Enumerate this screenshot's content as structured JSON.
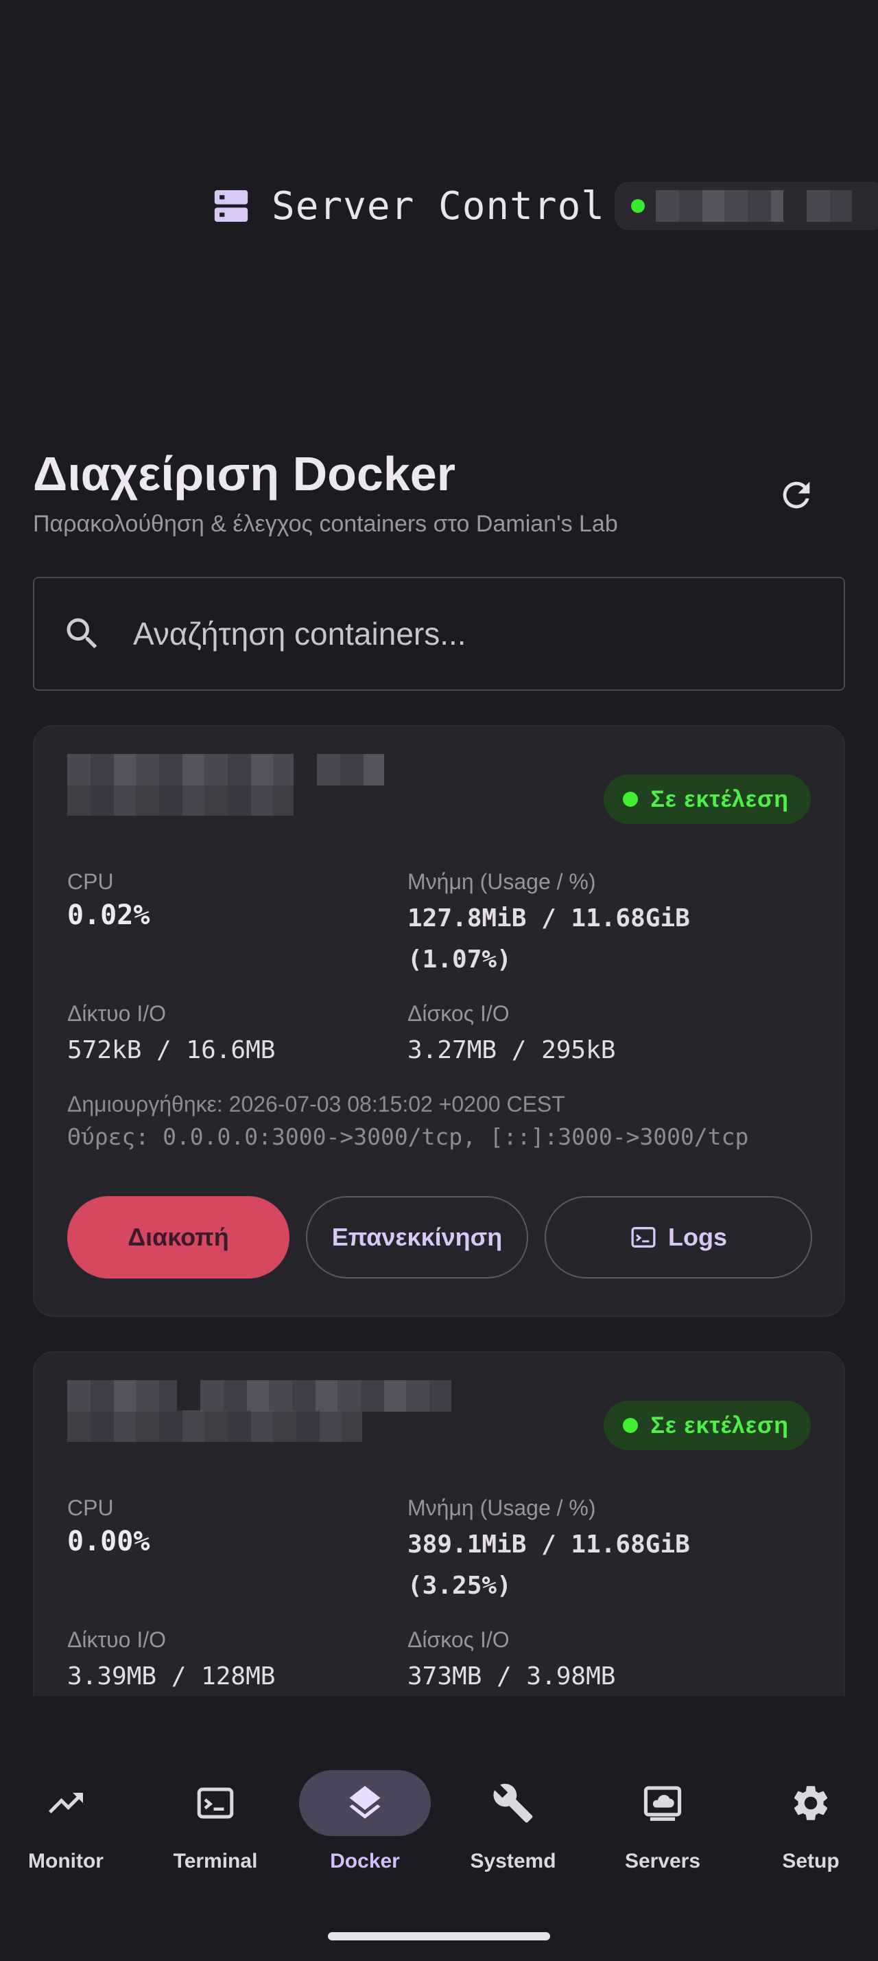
{
  "app": {
    "title": "Server Control",
    "status_color": "#39e830"
  },
  "header": {
    "title": "Διαχείριση Docker",
    "subtitle": "Παρακολούθηση & έλεγχος containers στο Damian's Lab",
    "refresh_icon": "refresh-icon"
  },
  "search": {
    "placeholder": "Αναζήτηση containers...",
    "value": ""
  },
  "containers": [
    {
      "status": "Σε εκτέλεση",
      "cpu_label": "CPU",
      "cpu": "0.02%",
      "mem_label": "Μνήμη (Usage / %)",
      "mem_line1": "127.8MiB / 11.68GiB",
      "mem_line2": "(1.07%)",
      "net_label": "Δίκτυο I/O",
      "net": "572kB / 16.6MB",
      "disk_label": "Δίσκος I/O",
      "disk": "3.27MB / 295kB",
      "created": "Δημιουργήθηκε: 2026-07-03 08:15:02 +0200 CEST",
      "ports": "Θύρες: 0.0.0.0:3000->3000/tcp, [::]:3000->3000/tcp",
      "stop_label": "Διακοπή",
      "restart_label": "Επανεκκίνηση",
      "logs_label": "Logs"
    },
    {
      "status": "Σε εκτέλεση",
      "cpu_label": "CPU",
      "cpu": "0.00%",
      "mem_label": "Μνήμη (Usage / %)",
      "mem_line1": "389.1MiB / 11.68GiB",
      "mem_line2": "(3.25%)",
      "net_label": "Δίκτυο I/O",
      "net": "3.39MB / 128MB",
      "disk_label": "Δίσκος I/O",
      "disk": "373MB / 3.98MB"
    }
  ],
  "nav": {
    "items": [
      {
        "label": "Monitor",
        "icon": "trending-up-icon"
      },
      {
        "label": "Terminal",
        "icon": "terminal-icon"
      },
      {
        "label": "Docker",
        "icon": "layers-icon",
        "active": true
      },
      {
        "label": "Systemd",
        "icon": "wrench-icon"
      },
      {
        "label": "Servers",
        "icon": "cloud-server-icon"
      },
      {
        "label": "Setup",
        "icon": "gear-icon"
      }
    ]
  }
}
